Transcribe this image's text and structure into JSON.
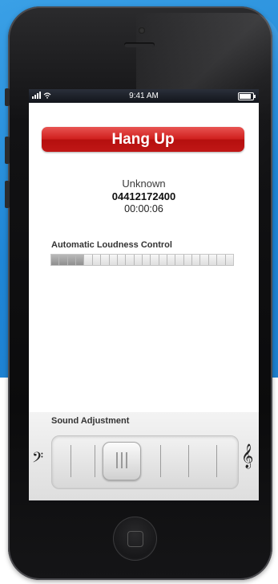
{
  "status_bar": {
    "time": "9:41 AM"
  },
  "call": {
    "hangup_label": "Hang Up",
    "caller_name": "Unknown",
    "caller_number": "04412172400",
    "duration": "00:00:06"
  },
  "loudness": {
    "label": "Automatic Loudness Control",
    "segments_total": 22,
    "segments_active": 4
  },
  "sound": {
    "label": "Sound Adjustment",
    "left_icon": "bass-clef-icon",
    "right_icon": "treble-clef-icon"
  },
  "colors": {
    "hangup": "#cf1e1c",
    "background_blue": "#1f86d6"
  }
}
